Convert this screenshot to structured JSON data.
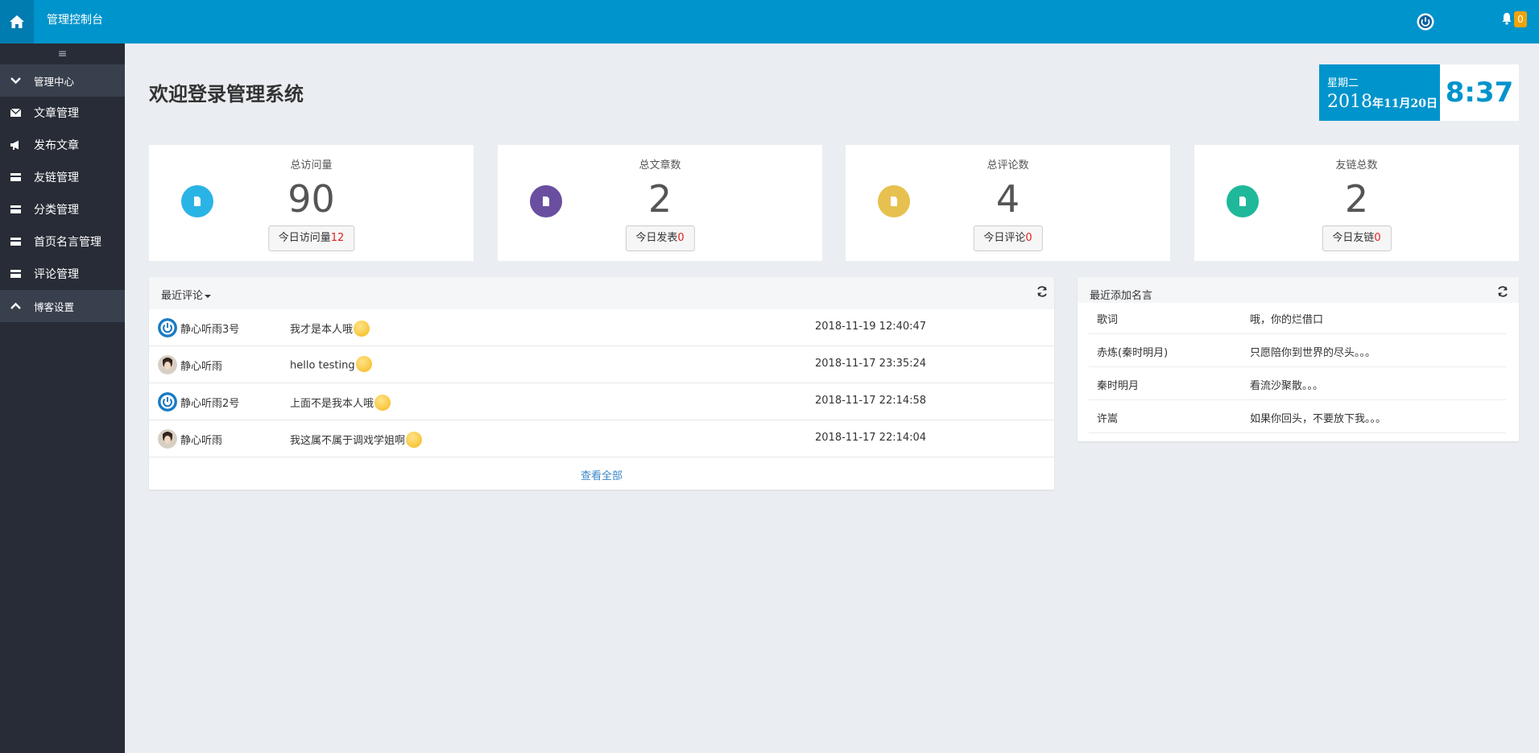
{
  "header": {
    "title": "管理控制台",
    "notification_count": "0",
    "accent_color": "#0094cc"
  },
  "sidebar": {
    "toggle": "≡",
    "items": [
      {
        "label": "管理中心",
        "icon": "chevron-down-icon",
        "group": true
      },
      {
        "label": "文章管理",
        "icon": "envelope-icon"
      },
      {
        "label": "发布文章",
        "icon": "bullhorn-icon"
      },
      {
        "label": "友链管理",
        "icon": "card-icon"
      },
      {
        "label": "分类管理",
        "icon": "card-icon"
      },
      {
        "label": "首页名言管理",
        "icon": "card-icon"
      },
      {
        "label": "评论管理",
        "icon": "card-icon"
      },
      {
        "label": "博客设置",
        "icon": "chevron-up-icon",
        "group": true
      }
    ]
  },
  "main": {
    "title": "欢迎登录管理系统",
    "date": {
      "weekday": "星期二",
      "year": "2018",
      "monthday": "年11月20日",
      "time": "8:37"
    },
    "stats": [
      {
        "label": "总访问量",
        "value": "90",
        "btn_label": "今日访问量",
        "btn_value": "12",
        "color": "#2ab4e6"
      },
      {
        "label": "总文章数",
        "value": "2",
        "btn_label": "今日发表",
        "btn_value": "0",
        "color": "#6a4fa0"
      },
      {
        "label": "总评论数",
        "value": "4",
        "btn_label": "今日评论",
        "btn_value": "0",
        "color": "#e7c14f"
      },
      {
        "label": "友链总数",
        "value": "2",
        "btn_label": "今日友链",
        "btn_value": "0",
        "color": "#1fb89a"
      }
    ]
  },
  "comments": {
    "title": "最近评论",
    "view_all": "查看全部",
    "rows": [
      {
        "name": "静心听雨3号",
        "text": "我才是本人哦",
        "time": "2018-11-19 12:40:47",
        "avatar": "power"
      },
      {
        "name": "静心听雨",
        "text": "hello testing",
        "time": "2018-11-17 23:35:24",
        "avatar": "photo"
      },
      {
        "name": "静心听雨2号",
        "text": "上面不是我本人哦",
        "time": "2018-11-17 22:14:58",
        "avatar": "power"
      },
      {
        "name": "静心听雨",
        "text": "我这属不属于调戏学姐啊",
        "time": "2018-11-17 22:14:04",
        "avatar": "photo"
      }
    ]
  },
  "quotes": {
    "title": "最近添加名言",
    "rows": [
      {
        "author": "歌词",
        "text": "哦，你的烂借口"
      },
      {
        "author": "赤炼(秦时明月)",
        "text": "只愿陪你到世界的尽头。。。"
      },
      {
        "author": "秦时明月",
        "text": "看流沙聚散。。。"
      },
      {
        "author": "许嵩",
        "text": "如果你回头，不要放下我。。。"
      }
    ]
  }
}
